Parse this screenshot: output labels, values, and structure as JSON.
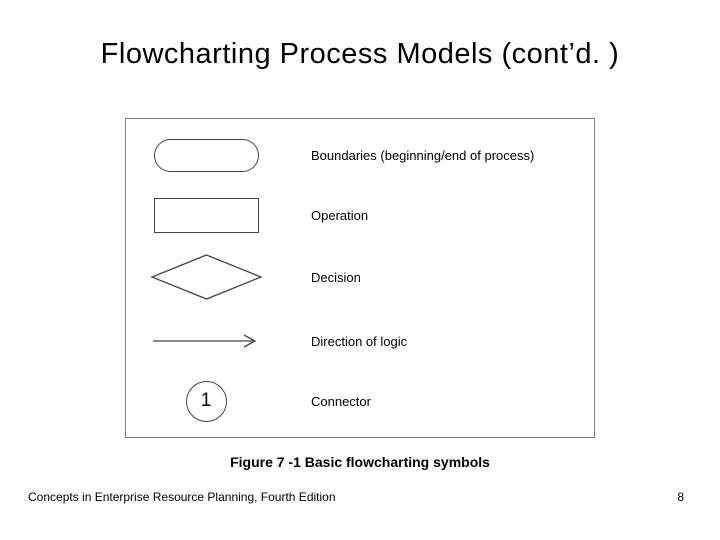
{
  "title": "Flowcharting Process Models (cont’d. )",
  "symbols": {
    "terminator_label": "Boundaries (beginning/end of process)",
    "operation_label": "Operation",
    "decision_label": "Decision",
    "arrow_label": "Direction of logic",
    "connector_label": "Connector",
    "connector_text": "1"
  },
  "caption": "Figure 7 -1  Basic flowcharting symbols",
  "footer": {
    "source": "Concepts in Enterprise Resource Planning, Fourth Edition",
    "page": "8"
  }
}
